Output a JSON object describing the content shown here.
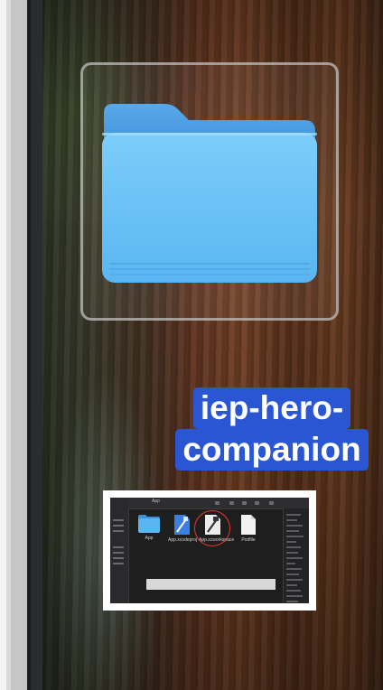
{
  "desktop": {
    "selected_folder": {
      "label_lines": [
        "iep-hero-",
        "companion"
      ],
      "icon": "folder-icon",
      "selection_color": "#2a56d3"
    },
    "screenshot_thumbnail": {
      "window_title": "App",
      "files": [
        {
          "name": "App",
          "icon": "folder-icon"
        },
        {
          "name": "App.xcodeproj",
          "icon": "xcodeproj-icon"
        },
        {
          "name": "App.xcworkspace",
          "icon": "xcworkspace-icon"
        },
        {
          "name": "Podfile",
          "icon": "document-icon"
        }
      ],
      "highlight_color": "#e03a2a"
    }
  }
}
